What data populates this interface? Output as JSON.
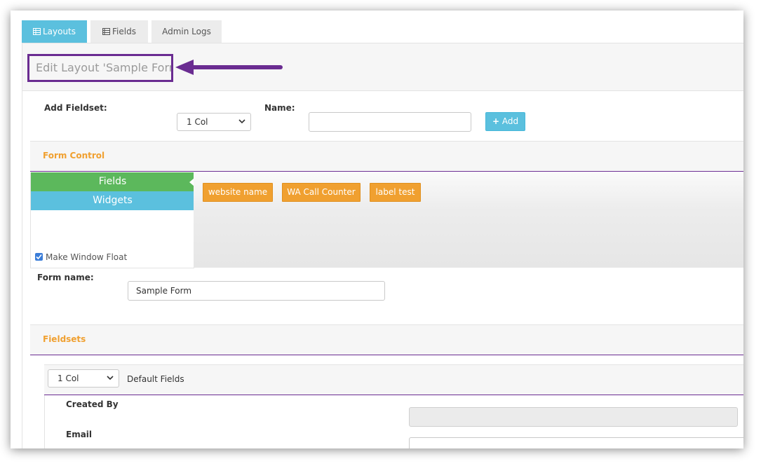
{
  "tabs": [
    {
      "label": "Layouts",
      "icon": "table-icon"
    },
    {
      "label": "Fields",
      "icon": "list-icon"
    },
    {
      "label": "Admin Logs"
    }
  ],
  "page_title": "Edit Layout 'Sample Form'",
  "add_fieldset": {
    "label": "Add Fieldset:",
    "columns_value": "1 Col",
    "name_label": "Name:",
    "name_value": "",
    "add_button": "Add"
  },
  "form_control": {
    "heading": "Form Control",
    "side_tabs": [
      "Fields",
      "Widgets"
    ],
    "make_window_float": "Make Window Float",
    "make_window_float_checked": true,
    "field_chips": [
      "website name",
      "WA Call Counter",
      "label test"
    ]
  },
  "form_name": {
    "label": "Form name:",
    "value": "Sample Form"
  },
  "fieldsets": {
    "heading": "Fieldsets",
    "columns_value": "1 Col",
    "name": "Default Fields",
    "fields": [
      {
        "label": "Created By",
        "value": ""
      },
      {
        "label": "Email",
        "value": ""
      }
    ]
  },
  "colors": {
    "accent_blue": "#5bc0de",
    "accent_green": "#5cb85c",
    "accent_orange": "#f0a030",
    "annotation_purple": "#6a2c91"
  }
}
